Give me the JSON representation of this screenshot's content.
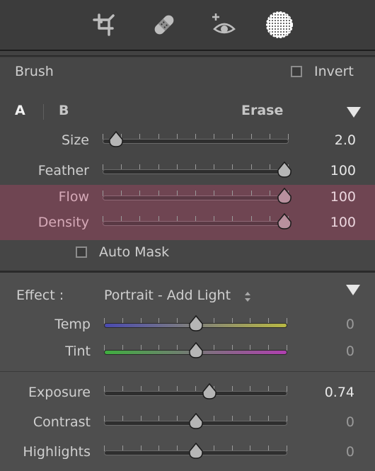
{
  "toolbar": {
    "tools": [
      {
        "icon": "crop-icon"
      },
      {
        "icon": "healing-bandage-icon"
      },
      {
        "icon": "red-eye-icon"
      },
      {
        "icon": "masking-brush-icon"
      }
    ]
  },
  "brush": {
    "title": "Brush",
    "invert_label": "Invert",
    "invert_checked": false,
    "tab_a": "A",
    "tab_b": "B",
    "erase_label": "Erase",
    "auto_mask_label": "Auto Mask",
    "auto_mask_checked": false,
    "sliders": [
      {
        "label": "Size",
        "value": "2.0",
        "position": 0.05,
        "highlighted": false
      },
      {
        "label": "Feather",
        "value": "100",
        "position": 1.0,
        "highlighted": false
      },
      {
        "label": "Flow",
        "value": "100",
        "position": 1.0,
        "highlighted": true
      },
      {
        "label": "Density",
        "value": "100",
        "position": 1.0,
        "highlighted": true
      }
    ]
  },
  "effect": {
    "label": "Effect :",
    "preset": "Portrait - Add Light",
    "sliders": [
      {
        "label": "Temp",
        "value": "0",
        "position": 0.5
      },
      {
        "label": "Tint",
        "value": "0",
        "position": 0.5
      },
      {
        "label": "Exposure",
        "value": "0.74",
        "position": 0.58
      },
      {
        "label": "Contrast",
        "value": "0",
        "position": 0.5
      },
      {
        "label": "Highlights",
        "value": "0",
        "position": 0.5
      }
    ]
  },
  "colors": {
    "highlight_row": "#6f4552",
    "temp_gradient": [
      "#4a4ab0",
      "#b8b843"
    ],
    "tint_gradient": [
      "#3fae3f",
      "#b03fb0"
    ]
  }
}
